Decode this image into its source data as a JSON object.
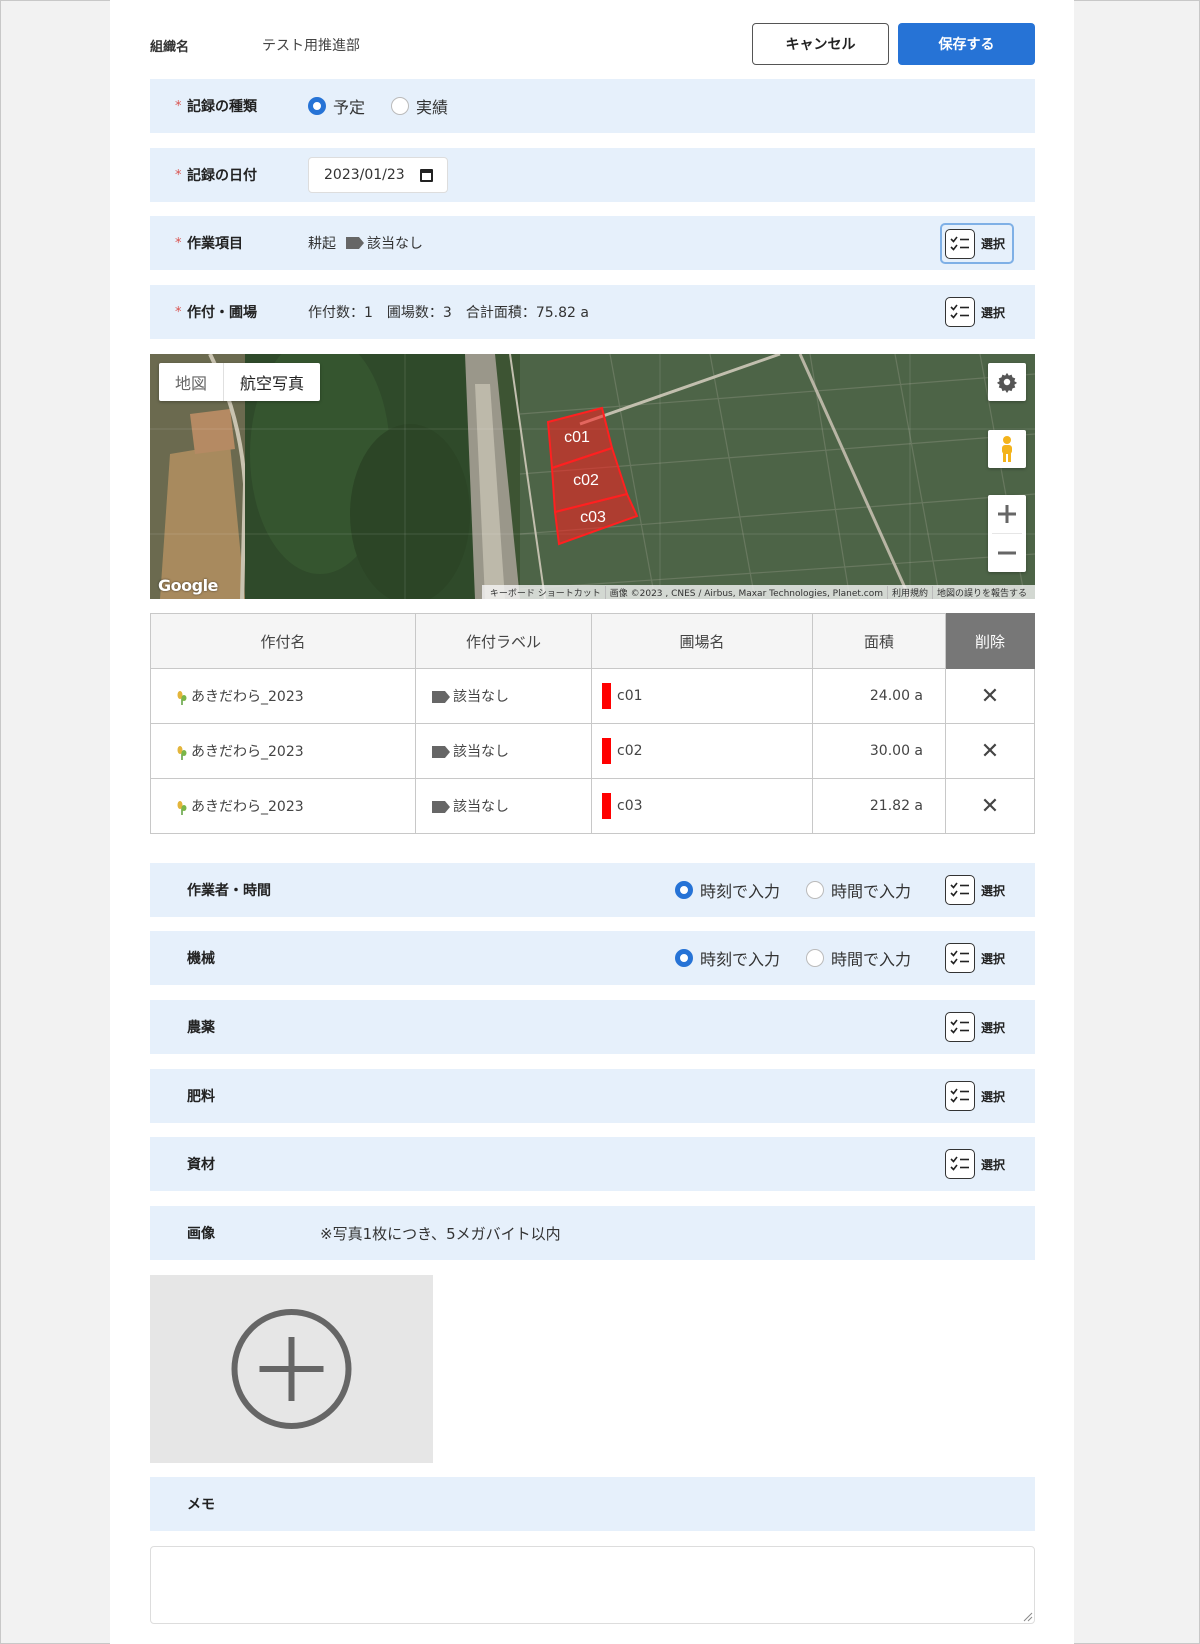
{
  "header": {
    "org_label": "組織名",
    "org_value": "テスト用推進部",
    "cancel_label": "キャンセル",
    "save_label": "保存する"
  },
  "record_type": {
    "label": "記録の種類",
    "required_mark": "*",
    "options": [
      "予定",
      "実績"
    ],
    "selected": "予定"
  },
  "record_date": {
    "label": "記録の日付",
    "required_mark": "*",
    "value": "2023/01/23"
  },
  "work_item": {
    "label": "作業項目",
    "required_mark": "*",
    "value": "耕起",
    "tag": "該当なし",
    "select_label": "選択"
  },
  "crop_field": {
    "label": "作付・圃場",
    "required_mark": "*",
    "summary": "作付数：1　圃場数：3　合計面積：75.82 a",
    "select_label": "選択"
  },
  "map": {
    "tabs": [
      "地図",
      "航空写真"
    ],
    "active_tab": "航空写真",
    "polygons": [
      "c01",
      "c02",
      "c03"
    ],
    "polygon_color": "#ff0000",
    "footer": [
      "キーボード ショートカット",
      "画像 ©2023 , CNES / Airbus, Maxar Technologies, Planet.com",
      "利用規約",
      "地図の誤りを報告する"
    ],
    "logo": "Google"
  },
  "table": {
    "headers": [
      "作付名",
      "作付ラベル",
      "圃場名",
      "面積",
      "削除"
    ],
    "rows": [
      {
        "crop": "あきだわら_2023",
        "label": "該当なし",
        "field": "c01",
        "area": "24.00 a"
      },
      {
        "crop": "あきだわら_2023",
        "label": "該当なし",
        "field": "c02",
        "area": "30.00 a"
      },
      {
        "crop": "あきだわら_2023",
        "label": "該当なし",
        "field": "c03",
        "area": "21.82 a"
      }
    ],
    "delete_symbol": "✕"
  },
  "sections": {
    "worker": {
      "label": "作業者・時間",
      "opt1": "時刻で入力",
      "opt2": "時間で入力",
      "select_label": "選択"
    },
    "machine": {
      "label": "機械",
      "opt1": "時刻で入力",
      "opt2": "時間で入力",
      "select_label": "選択"
    },
    "pesticide": {
      "label": "農薬",
      "select_label": "選択"
    },
    "fertilizer": {
      "label": "肥料",
      "select_label": "選択"
    },
    "material": {
      "label": "資材",
      "select_label": "選択"
    },
    "image": {
      "label": "画像",
      "note": "※写真1枚につき、5メガバイト以内"
    },
    "memo": {
      "label": "メモ",
      "value": ""
    }
  },
  "colors": {
    "accent": "#2673d6",
    "row_bg": "#e6f0fb",
    "required": "#d9534f"
  }
}
